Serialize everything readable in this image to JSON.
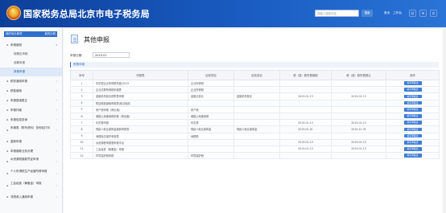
{
  "header": {
    "site_title": "国家税务总局北京市电子税务局",
    "search_placeholder": "请输入搜索内容",
    "search_button": "搜索",
    "links": [
      "首页",
      "工作台"
    ]
  },
  "sidebar": {
    "top_left": "我的待办事项",
    "top_right": "我的办税",
    "menu": [
      {
        "label": "申报缴税",
        "level": 1,
        "expanded": true
      },
      {
        "label": "按期应申报",
        "level": 2
      },
      {
        "label": "逾期申报",
        "level": 2
      },
      {
        "label": "其他申报",
        "level": 2,
        "active": true
      },
      {
        "label": "税务通用申报",
        "level": 1
      },
      {
        "label": "税费缴纳",
        "level": 1
      },
      {
        "label": "申报错误更正",
        "level": 1
      },
      {
        "label": "申报作废",
        "level": 1
      },
      {
        "label": "申报信息查询",
        "level": 1
      },
      {
        "label": "申报表（附列资料）查询及打印",
        "level": 1
      },
      {
        "label": "重新申报",
        "level": 1
      },
      {
        "label": "申报缴款业务办理",
        "level": 1
      },
      {
        "label": "水资源税缴款凭证申请",
        "level": 1
      },
      {
        "label": "个人所得税生产经营所得申报",
        "level": 1
      },
      {
        "label": "工会经费（筹备金）申报",
        "level": 1
      },
      {
        "label": "非税收入通用申报",
        "level": 1
      }
    ]
  },
  "main": {
    "title": "其他申报",
    "date_label": "申报日期:",
    "date_value": "2019-01",
    "section_title": "税费申报",
    "table": {
      "headers": [
        "序号",
        "申报表",
        "征收项目",
        "征收品目",
        "税（费）款所属期起",
        "税（费）款所属期止",
        "操作"
      ],
      "op_label": "填写申报表",
      "rows": [
        [
          "1",
          "印花税企业所得税年度(2015",
          "企业所得税",
          "",
          "",
          ""
        ],
        [
          "2",
          "企业清算所得税申报表",
          "企业所得税",
          "",
          "",
          ""
        ],
        [
          "3",
          "金融机构营业税附表申报",
          "金融业营业",
          "金融机构营业",
          "2019-01-13",
          "2019-01-13"
        ],
        [
          "4",
          "附加税费缴纳申报表(依法免除",
          "",
          "",
          "",
          ""
        ],
        [
          "5",
          "房产税申报（房出租）",
          "房产税",
          "",
          "",
          ""
        ],
        [
          "6",
          "城镇土地使用税申报（房出租）",
          "城镇土地使用税",
          "",
          "",
          ""
        ],
        [
          "7",
          "印花税申报",
          "印花税",
          "",
          "2019-01-13",
          "2019-01-13"
        ],
        [
          "8",
          "残疾人就业保障金缴费申报表",
          "残疾人就业保障金",
          "残疾人就业保障金",
          "2019-01-01",
          "2019-12-31"
        ],
        [
          "9",
          "地理标志保护申报表",
          "地理税",
          "",
          "",
          ""
        ],
        [
          "10",
          "水资源税申报表申报平台",
          "",
          "",
          "2019-01-13",
          "2019-01-13"
        ],
        [
          "11",
          "工会经费（筹备金）申报",
          "",
          "",
          "2019-01-13",
          "2019-01-13"
        ],
        [
          "12",
          "环境保护税申报",
          "环境保护税",
          "",
          "",
          ""
        ]
      ]
    }
  }
}
